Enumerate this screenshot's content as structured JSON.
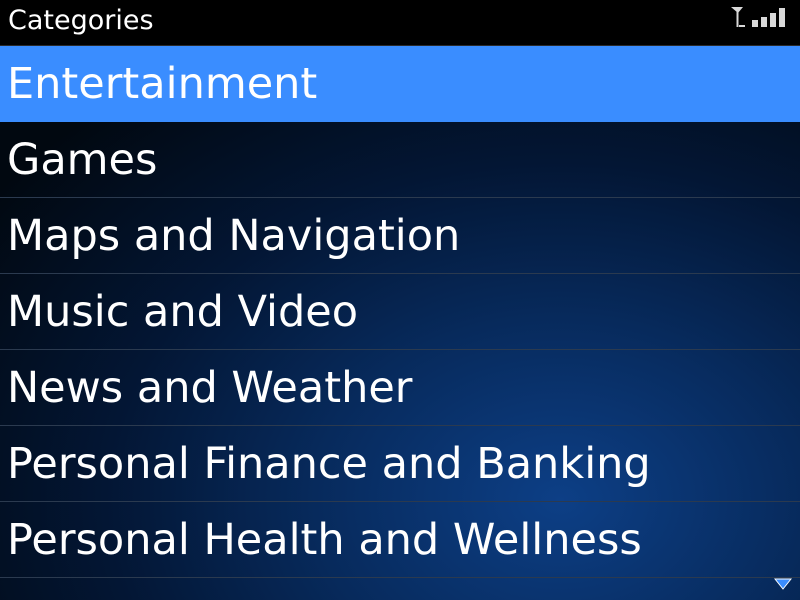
{
  "header": {
    "title": "Categories",
    "signal_icon": "signal-strength-icon"
  },
  "list": {
    "selected_index": 0,
    "selection_color": "#3a8dff",
    "items": [
      {
        "label": "Entertainment"
      },
      {
        "label": "Games"
      },
      {
        "label": "Maps and Navigation"
      },
      {
        "label": "Music and Video"
      },
      {
        "label": "News and Weather"
      },
      {
        "label": "Personal Finance and Banking"
      },
      {
        "label": "Personal Health and Wellness"
      }
    ]
  },
  "scroll_indicator": {
    "icon": "scroll-down-arrow-icon",
    "color": "#3a8dff"
  }
}
